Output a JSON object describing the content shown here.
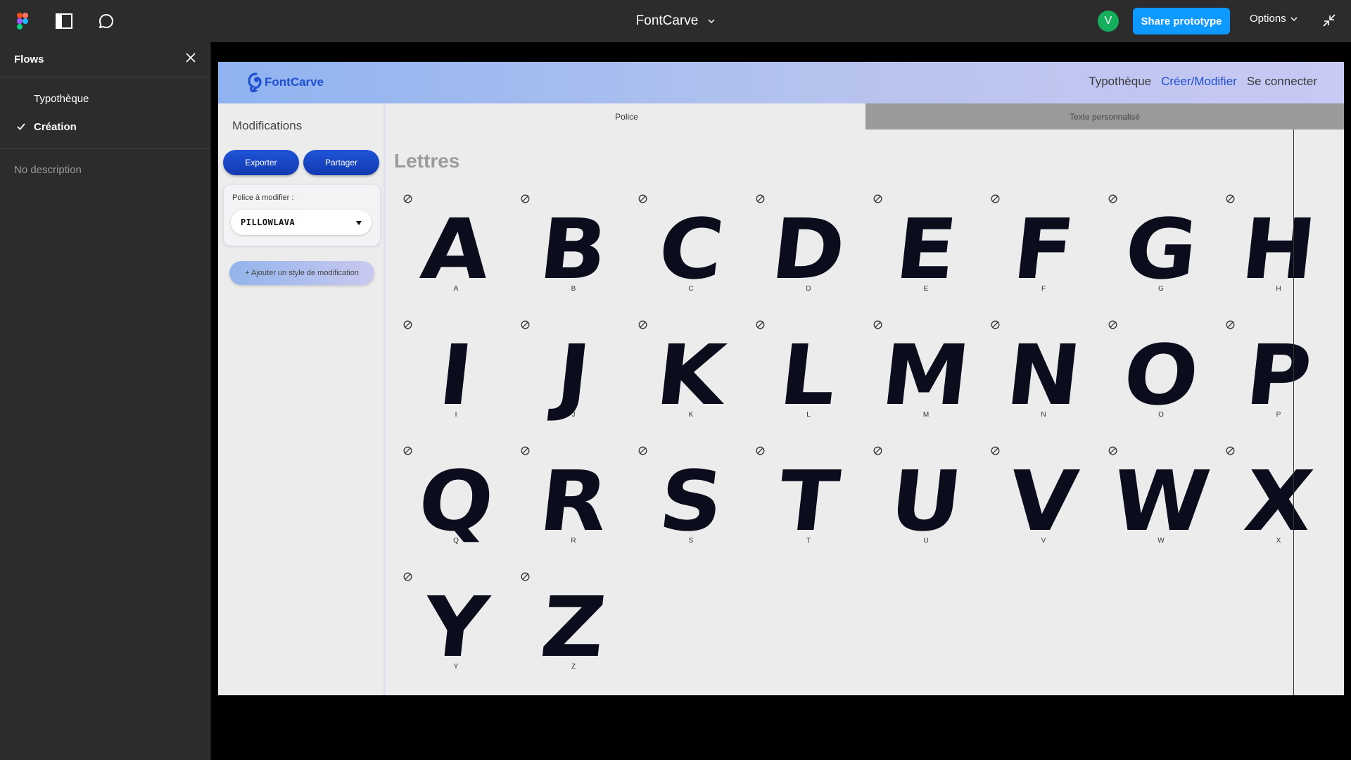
{
  "topbar": {
    "title": "FontCarve",
    "avatar_letter": "V",
    "share_label": "Share prototype",
    "options_label": "Options",
    "icons": [
      "figma-logo-icon",
      "panel-toggle-icon",
      "comment-icon",
      "chevron-down-icon",
      "collapse-icon"
    ],
    "colors": {
      "share": "#0d99ff",
      "avatar": "#14ae5c",
      "bar": "#2c2c2c"
    }
  },
  "flows": {
    "heading": "Flows",
    "items": [
      {
        "label": "Typothèque",
        "selected": false
      },
      {
        "label": "Création",
        "selected": true
      }
    ],
    "description": "No description"
  },
  "site": {
    "logo_text": "FontCarve",
    "nav": [
      "Typothèque",
      "Créer/Modifier",
      "Se connecter"
    ],
    "nav_active": "Créer/Modifier",
    "sidebar": {
      "title": "Modifications",
      "export_label": "Exporter",
      "share_label": "Partager",
      "font_label": "Police à modifier :",
      "font_value": "PILLOWLAVA",
      "add_style_label": "+ Ajouter un style de modification"
    },
    "tabs": [
      "Police",
      "Texte personnalisé"
    ],
    "section_title": "Lettres",
    "letters": [
      "A",
      "B",
      "C",
      "D",
      "E",
      "F",
      "G",
      "H",
      "I",
      "J",
      "K",
      "L",
      "M",
      "N",
      "O",
      "P",
      "Q",
      "R",
      "S",
      "T",
      "U",
      "V",
      "W",
      "X",
      "Y",
      "Z"
    ],
    "colors": {
      "primary": "#1d4fd0",
      "glyph": "#0b0d1c"
    }
  }
}
